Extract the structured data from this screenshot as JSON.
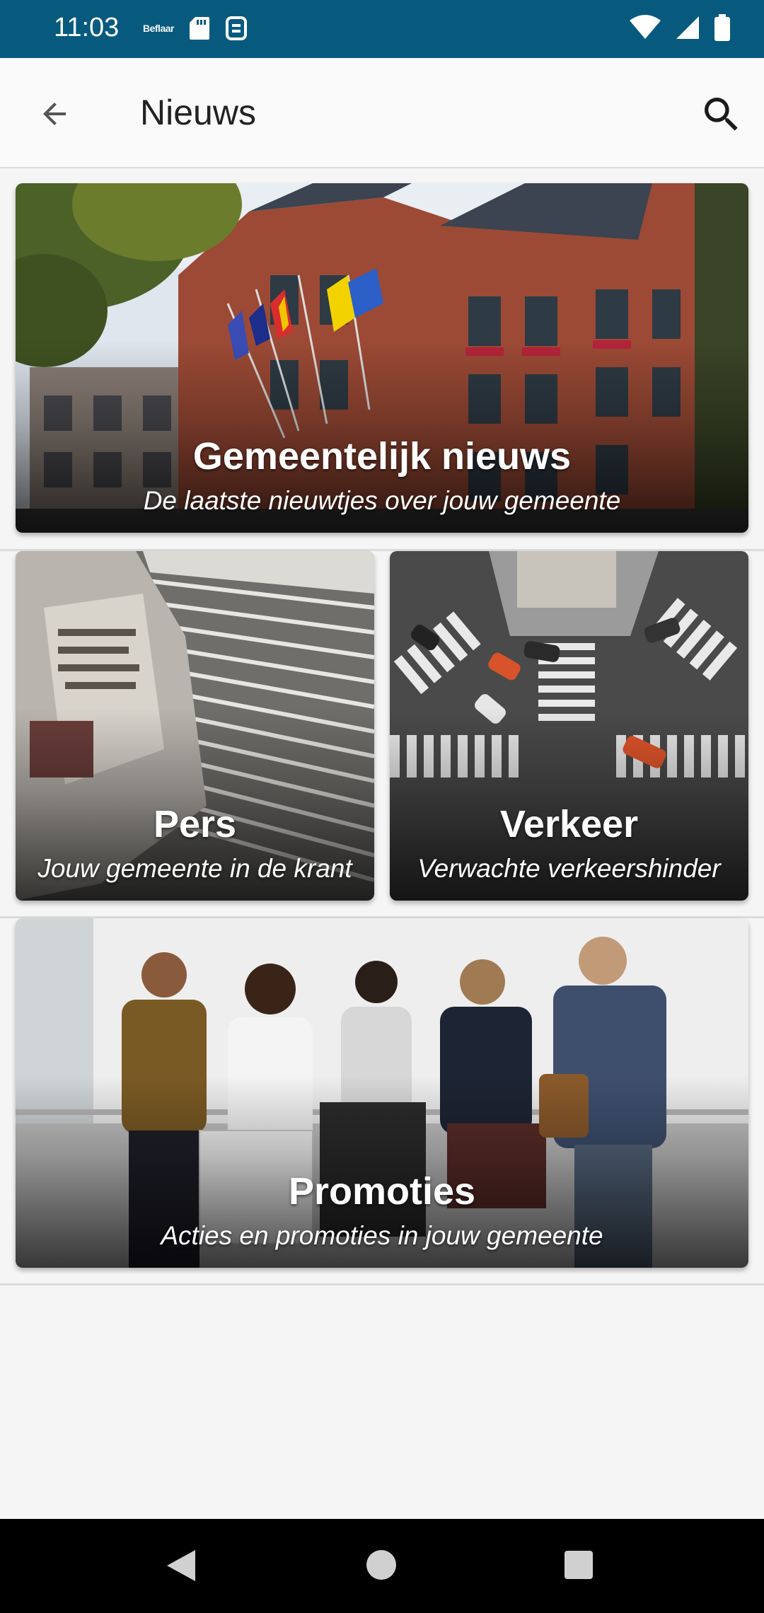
{
  "status_bar": {
    "time": "11:03",
    "brand_mark": "Beflaar",
    "left_icons": [
      "brand-logo-icon",
      "sd-card-icon",
      "app-notification-icon"
    ],
    "right_icons": [
      "wifi-icon",
      "signal-icon",
      "battery-icon"
    ]
  },
  "app_bar": {
    "title": "Nieuws",
    "back_icon": "arrow-back-icon",
    "search_icon": "search-icon"
  },
  "cards": [
    {
      "title": "Gemeentelijk nieuws",
      "subtitle": "De laatste nieuwtjes over jouw gemeente",
      "image": "town-hall-with-flags"
    },
    {
      "title": "Pers",
      "subtitle": "Jouw gemeente in de krant",
      "image": "newspaper-stack"
    },
    {
      "title": "Verkeer",
      "subtitle": "Verwachte verkeershinder",
      "image": "city-crosswalk-intersection"
    },
    {
      "title": "Promoties",
      "subtitle": "Acties en promoties in jouw gemeente",
      "image": "shoppers-with-bags"
    }
  ],
  "nav_bar": {
    "buttons": [
      "nav-back-icon",
      "nav-home-icon",
      "nav-recents-icon"
    ]
  },
  "colors": {
    "status_bar": "#075a7e",
    "app_bar": "#fafafa",
    "background": "#f5f5f5"
  }
}
